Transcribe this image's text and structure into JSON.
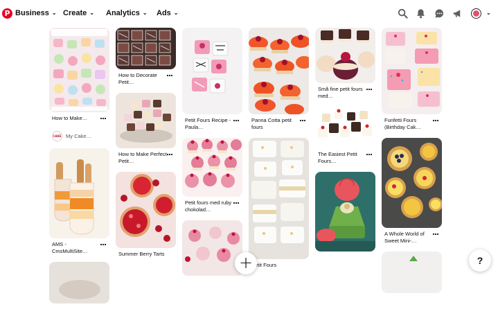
{
  "header": {
    "logo_letter": "P",
    "nav": [
      {
        "label": "Business"
      },
      {
        "label": "Create"
      },
      {
        "label": "Analytics"
      },
      {
        "label": "Ads"
      }
    ],
    "icons": [
      "search-icon",
      "bell-icon",
      "messages-icon",
      "megaphone-icon",
      "profile-avatar",
      "chevron-down-icon"
    ],
    "accent_color": "#e60023"
  },
  "pins": {
    "col1": [
      {
        "title": "How to Make…",
        "creator": "My Cake…",
        "creator_badge": "CAKE"
      },
      {
        "title": "AMS - CmsMultiSite…"
      },
      {
        "title": ""
      }
    ],
    "col2": [
      {
        "title": "How to Decorate Petit…"
      },
      {
        "title": "How to Make Perfect Petit…"
      },
      {
        "title": "Summer Berry Tarts"
      }
    ],
    "col3": [
      {
        "title": "Petit Fours Recipe - Paula…"
      },
      {
        "title": "Petit fours med ruby chokolad…"
      },
      {
        "title": ""
      }
    ],
    "col4": [
      {
        "title": "Panna Cotta petit fours"
      },
      {
        "title": "Petit Fours"
      }
    ],
    "col5": [
      {
        "title": "Små fine petit fours med…"
      },
      {
        "title": "The Easiest Petit Fours…"
      },
      {
        "title": ""
      }
    ],
    "col6": [
      {
        "title": "Funfetti Fours (Birthday Cak…"
      },
      {
        "title": "A Whole World of Sweet Mini-…"
      },
      {
        "title": ""
      }
    ]
  },
  "fab": {
    "label": "+"
  },
  "help": {
    "label": "?"
  }
}
